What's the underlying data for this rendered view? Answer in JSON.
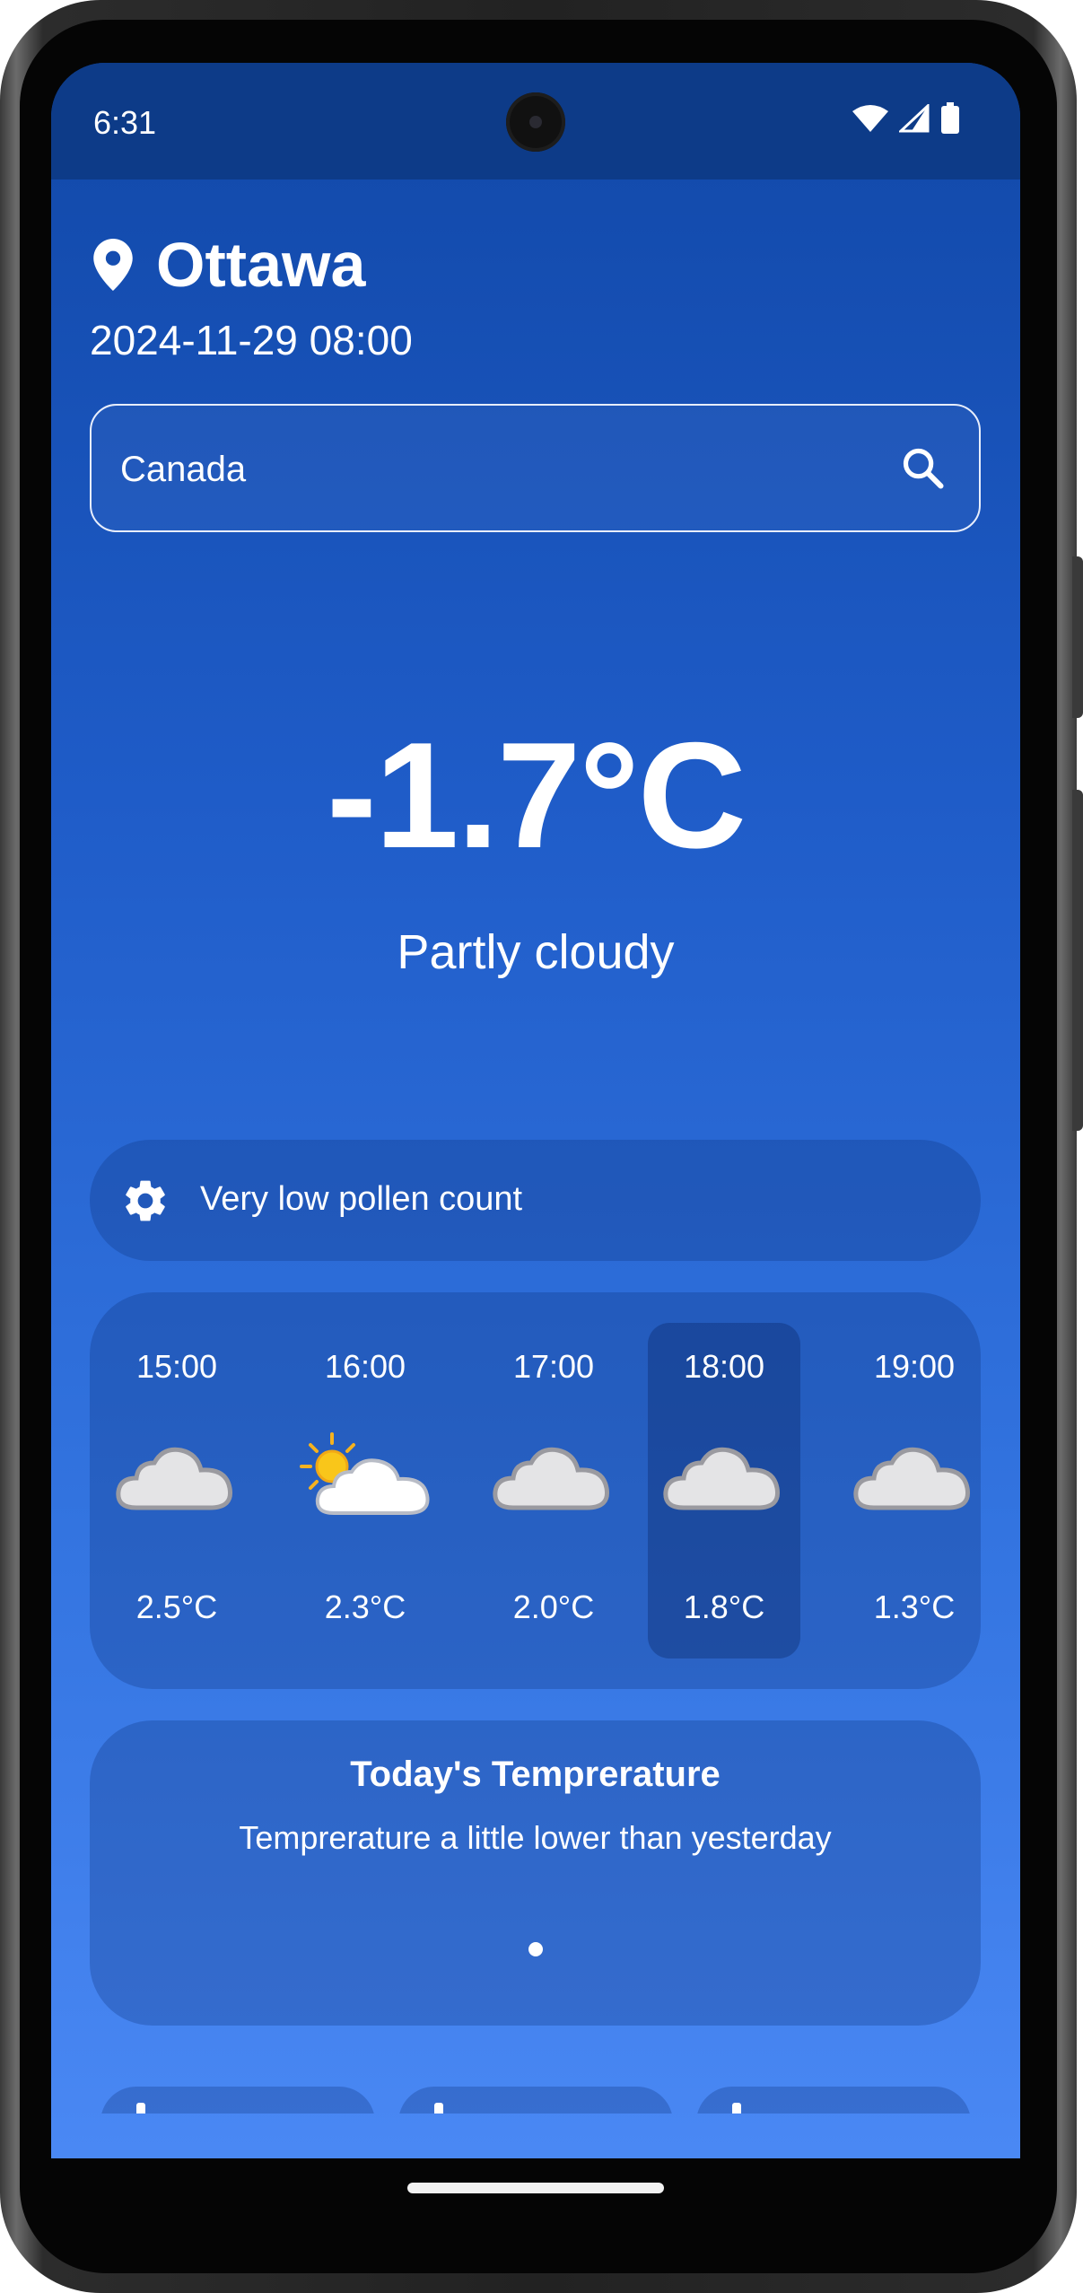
{
  "status_bar": {
    "time": "6:31",
    "icons": [
      "wifi-icon",
      "cellular-signal-icon",
      "battery-icon"
    ]
  },
  "location": {
    "icon": "location-pin-icon",
    "city": "Ottawa",
    "datetime": "2024-11-29 08:00"
  },
  "search": {
    "value": "Canada",
    "icon": "search-icon"
  },
  "current": {
    "temperature": "-1.7°C",
    "condition": "Partly cloudy"
  },
  "pollen": {
    "icon": "gear-icon",
    "text": "Very low pollen count"
  },
  "hourly": [
    {
      "time": "15:00",
      "icon": "cloud-icon",
      "temp": "2.5°C",
      "selected": false
    },
    {
      "time": "16:00",
      "icon": "sun-behind-cloud-icon",
      "temp": "2.3°C",
      "selected": false
    },
    {
      "time": "17:00",
      "icon": "cloud-icon",
      "temp": "2.0°C",
      "selected": false
    },
    {
      "time": "18:00",
      "icon": "cloud-icon",
      "temp": "1.8°C",
      "selected": true
    },
    {
      "time": "19:00",
      "icon": "cloud-icon",
      "temp": "1.3°C",
      "selected": false
    }
  ],
  "temperature_card": {
    "title": "Today's Temprerature",
    "subtitle": "Temprerature a little lower than yesterday",
    "page_indicator": {
      "current": 1,
      "total": 1
    }
  },
  "colors": {
    "status_bar": "#0d3b88",
    "gradient_top": "#1148a8",
    "gradient_bottom": "#4a88f4",
    "card": "rgba(10,45,120,0.28)",
    "text": "#ffffff"
  }
}
